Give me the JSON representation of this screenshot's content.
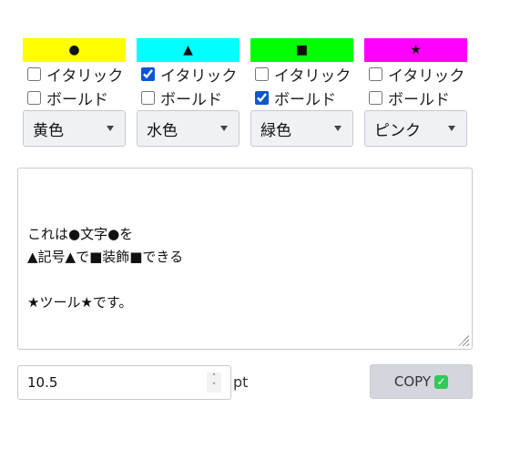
{
  "columns": [
    {
      "symbol": "●",
      "swatch_color": "#ffff00",
      "italic_label": "イタリック",
      "italic_checked": false,
      "bold_label": "ボールド",
      "bold_checked": false,
      "color_select_value": "黄色"
    },
    {
      "symbol": "▲",
      "swatch_color": "#00ffff",
      "italic_label": "イタリック",
      "italic_checked": true,
      "bold_label": "ボールド",
      "bold_checked": false,
      "color_select_value": "水色"
    },
    {
      "symbol": "■",
      "swatch_color": "#00ff00",
      "italic_label": "イタリック",
      "italic_checked": false,
      "bold_label": "ボールド",
      "bold_checked": true,
      "color_select_value": "緑色"
    },
    {
      "symbol": "★",
      "swatch_color": "#ff00ff",
      "italic_label": "イタリック",
      "italic_checked": false,
      "bold_label": "ボールド",
      "bold_checked": false,
      "color_select_value": "ピンク"
    }
  ],
  "editor": {
    "text": "これは●文字●を\n▲記号▲で■装飾■できる\n\n★ツール★です。"
  },
  "font_size": {
    "value": "10.5",
    "unit": "pt"
  },
  "copy_button": {
    "label": "COPY",
    "icon": "check-icon",
    "icon_color": "#34c759"
  }
}
